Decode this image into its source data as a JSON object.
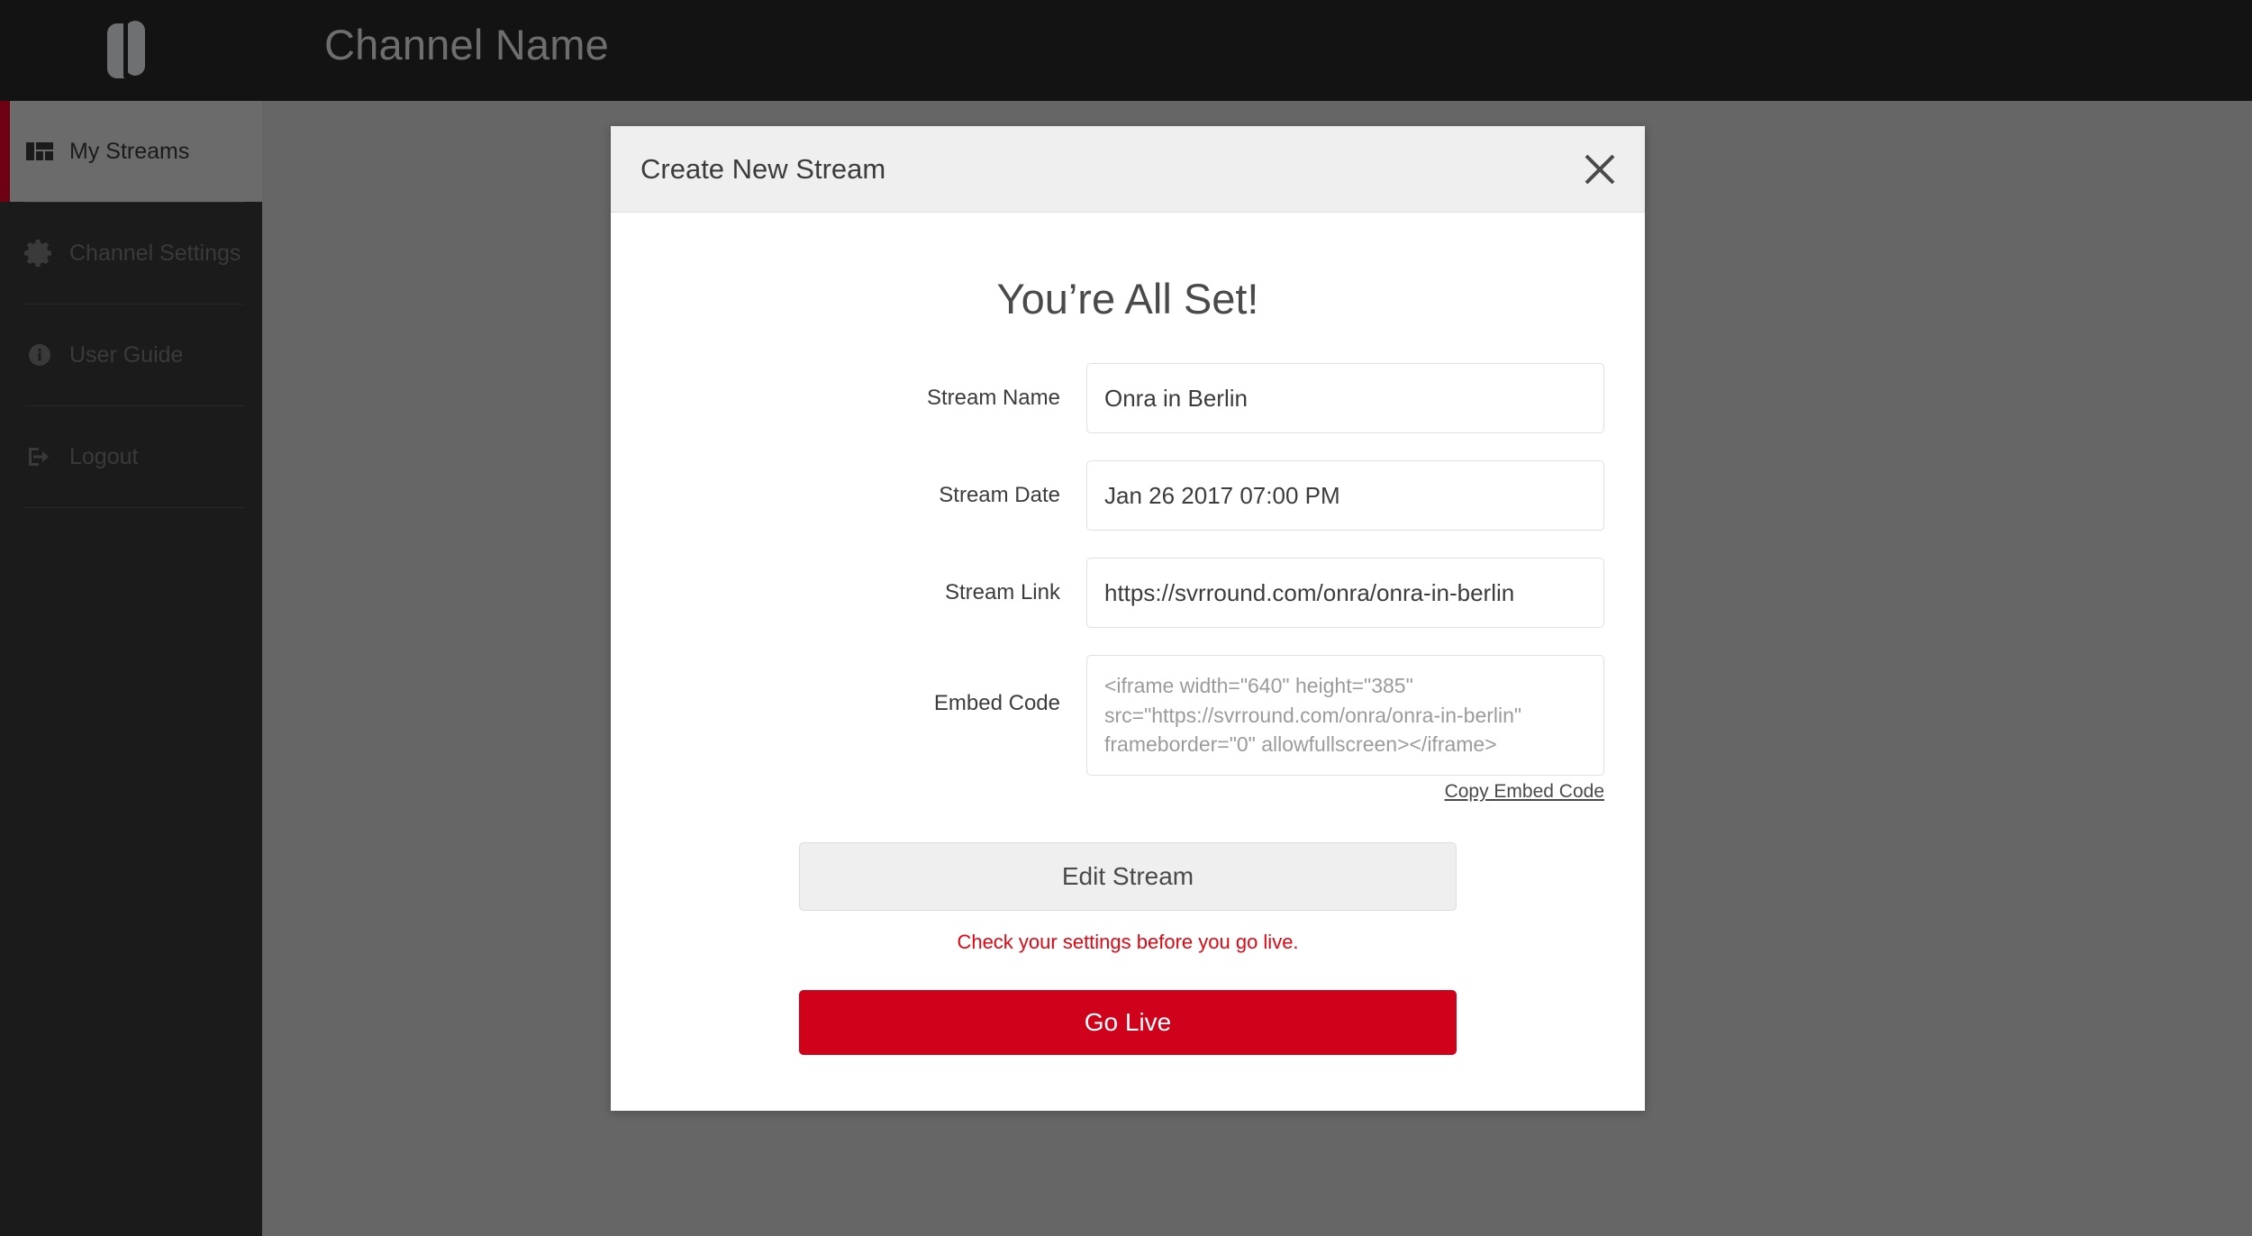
{
  "topbar": {
    "logo_name": "svrround-logo",
    "channel_title": "Channel Name"
  },
  "sidebar": {
    "items": [
      {
        "label": "My Streams",
        "icon": "dashboard-icon",
        "active": true
      },
      {
        "label": "Channel Settings",
        "icon": "gear-icon",
        "active": false
      },
      {
        "label": "User Guide",
        "icon": "info-icon",
        "active": false
      },
      {
        "label": "Logout",
        "icon": "logout-icon",
        "active": false
      }
    ]
  },
  "modal": {
    "title": "Create New Stream",
    "close_icon": "close-icon",
    "heading": "You’re All Set!",
    "fields": [
      {
        "label": "Stream Name",
        "value": "Onra in Berlin"
      },
      {
        "label": "Stream Date",
        "value": "Jan 26 2017 07:00 PM"
      },
      {
        "label": "Stream Link",
        "value": "https://svrround.com/onra/onra-in-berlin"
      }
    ],
    "embed": {
      "label": "Embed Code",
      "value": "<iframe width=\"640\" height=\"385\" src=\"https://svrround.com/onra/onra-in-berlin\" frameborder=\"0\" allowfullscreen></iframe>",
      "copy_link": "Copy Embed Code"
    },
    "edit_button": "Edit Stream",
    "warning": "Check your settings before you go live.",
    "golive_button": "Go Live"
  },
  "colors": {
    "brand_red": "#d0021b",
    "accent_dark_red": "#6e0014",
    "warning_red": "#e30613",
    "topbar_bg": "#131313",
    "sidebar_bg": "#1b1b1b",
    "overlay_bg": "#666666",
    "modal_header_bg": "#efefef"
  }
}
